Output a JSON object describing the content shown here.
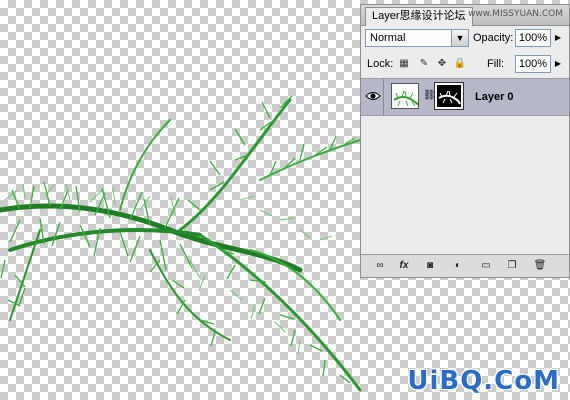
{
  "panel": {
    "tab_title": "Layer",
    "tab_watermark_cn": "思缘设计论坛",
    "tab_watermark_url": "www.MISSYUAN.COM",
    "blend_mode": "Normal",
    "opacity_label": "Opacity:",
    "opacity_value": "100%",
    "lock_label": "Lock:",
    "fill_label": "Fill:",
    "fill_value": "100%",
    "layers": [
      {
        "name": "Layer 0",
        "visible": true,
        "has_mask": true,
        "selected": true
      }
    ],
    "bottom_icons": [
      "link-icon",
      "fx-icon",
      "add-mask-icon",
      "adjustment-layer-icon",
      "folder-icon",
      "new-layer-icon",
      "trash-icon"
    ]
  },
  "watermark": "UiBQ.CoM",
  "colors": {
    "layer_selected": "#b6b7c9",
    "watermark": "#2a6cc9",
    "plant_green": "#2e9e32"
  }
}
